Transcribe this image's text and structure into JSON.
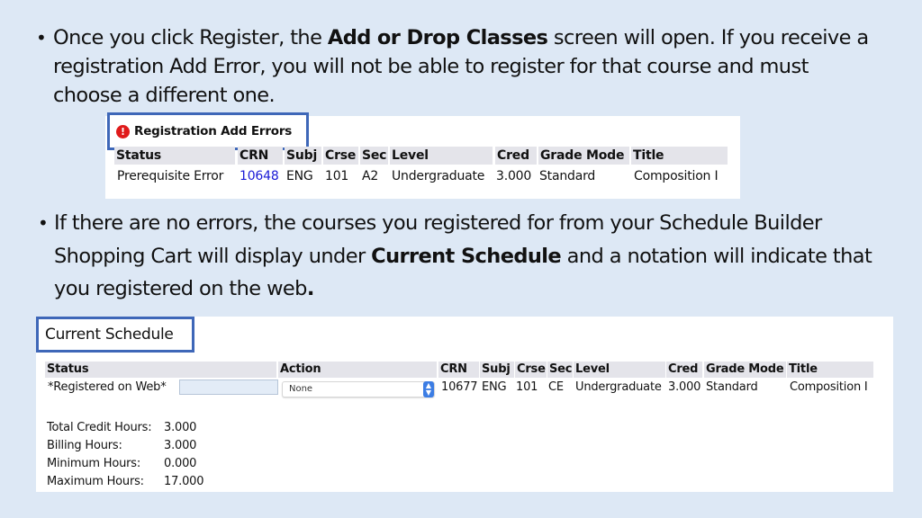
{
  "bullets": [
    {
      "parts": [
        {
          "text": "Once you click Register, the ",
          "bold": false
        },
        {
          "text": "Add or Drop Classes",
          "bold": true
        },
        {
          "text": " screen will open.  If you receive a registration Add Error, you will not be able to register for that course and must choose a different one.",
          "bold": false
        }
      ]
    },
    {
      "parts": [
        {
          "text": "If there are no errors, the courses you registered for from your Schedule Builder Shopping Cart will display under ",
          "bold": false
        },
        {
          "text": "Current Schedule",
          "bold": true
        },
        {
          "text": " and a notation will indicate that you registered on the web",
          "bold": false
        },
        {
          "text": ".",
          "bold": true
        }
      ]
    }
  ],
  "bullet_glyph": "•",
  "add_errors": {
    "title": "Registration Add Errors",
    "icon": "error-exclamation-icon",
    "icon_glyph": "!",
    "columns": [
      "Status",
      "CRN",
      "Subj",
      "Crse",
      "Sec",
      "Level",
      "Cred",
      "Grade Mode",
      "Title"
    ],
    "rows": [
      {
        "Status": "Prerequisite Error",
        "CRN": "10648",
        "Subj": "ENG",
        "Crse": "101",
        "Sec": "A2",
        "Level": "Undergraduate",
        "Cred": "3.000",
        "Grade Mode": "Standard",
        "Title": "Composition I"
      }
    ]
  },
  "current_schedule": {
    "title": "Current Schedule",
    "columns": [
      "Status",
      "Action",
      "CRN",
      "Subj",
      "Crse",
      "Sec",
      "Level",
      "Cred",
      "Grade Mode",
      "Title"
    ],
    "rows": [
      {
        "Status": "*Registered on Web*",
        "Status_input": "",
        "Action": "None",
        "CRN": "10677",
        "Subj": "ENG",
        "Crse": "101",
        "Sec": "CE",
        "Level": "Undergraduate",
        "Cred": "3.000",
        "Grade Mode": "Standard",
        "Title": "Composition I"
      }
    ],
    "hours": [
      {
        "label": "Total Credit Hours:",
        "value": "3.000"
      },
      {
        "label": "Billing Hours:",
        "value": "3.000"
      },
      {
        "label": "Minimum Hours:",
        "value": "0.000"
      },
      {
        "label": "Maximum Hours:",
        "value": "17.000"
      }
    ]
  },
  "colors": {
    "background": "#dde8f5",
    "highlight_border": "#3e67b8",
    "link": "#1a1ad6",
    "error_icon": "#e01b1b",
    "header_bg": "#e4e4ea"
  }
}
